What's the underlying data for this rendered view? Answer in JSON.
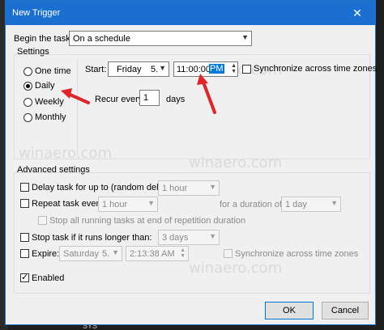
{
  "window": {
    "title": "New Trigger",
    "close_glyph": "✕"
  },
  "begin_task": {
    "label": "Begin the task:",
    "value": "On a schedule"
  },
  "settings": {
    "group_label": "Settings",
    "radios": [
      {
        "label": "One time",
        "selected": false
      },
      {
        "label": "Daily",
        "selected": true
      },
      {
        "label": "Weekly",
        "selected": false
      },
      {
        "label": "Monthly",
        "selected": false
      }
    ],
    "start_label": "Start:",
    "start_date_day": "Friday",
    "start_date_rest": "5.",
    "start_time": "11:00:00",
    "start_time_ampm": "PM",
    "sync_label": "Synchronize across time zones",
    "recur_label": "Recur every:",
    "recur_value": "1",
    "recur_unit": "days"
  },
  "advanced": {
    "group_label": "Advanced settings",
    "delay_label": "Delay task for up to (random delay):",
    "delay_value": "1 hour",
    "repeat_label": "Repeat task every:",
    "repeat_value": "1 hour",
    "duration_label": "for a duration of:",
    "duration_value": "1 day",
    "stop_running_label": "Stop all running tasks at end of repetition duration",
    "stop_if_label": "Stop task if it runs longer than:",
    "stop_if_value": "3 days",
    "expire_label": "Expire:",
    "expire_date_day": "Saturday",
    "expire_date_rest": "5.",
    "expire_time": "2:13:38 AM",
    "expire_sync_label": "Synchronize across time zones",
    "enabled_label": "Enabled",
    "enabled_checked": true
  },
  "buttons": {
    "ok": "OK",
    "cancel": "Cancel"
  },
  "background": {
    "snippet": "SYS"
  },
  "watermarks": [
    "winaero.com",
    "winaero.com",
    "winaero.com",
    "winaero.com"
  ],
  "colors": {
    "titlebar": "#1a6fd1",
    "arrow": "#e0242a",
    "selection": "#0078d7"
  }
}
